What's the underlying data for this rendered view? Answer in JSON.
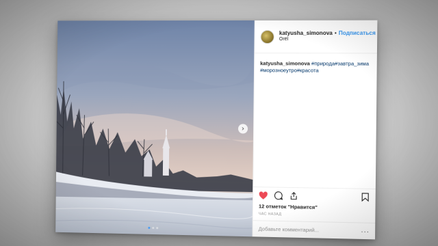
{
  "post": {
    "username": "katyusha_simonova",
    "follow_label": "Подписаться",
    "location": "Orël",
    "caption_user": "katyusha_simonova",
    "caption_tags": "#природа#завтра_зима#морозноеутро#красота",
    "likes_text": "12 отметок \"Нравится\"",
    "time_text": "час назад",
    "comment_placeholder": "Добавьте комментарий...",
    "more_glyph": "···",
    "next_glyph": "›",
    "bullet": "•"
  },
  "photo": {
    "subject": "frozen river at dawn with bell tower and bare trees",
    "slide_count": 3,
    "active_slide": 1
  },
  "icons": {
    "like": "heart-icon",
    "comment": "comment-icon",
    "share": "share-icon",
    "save": "bookmark-icon",
    "like_color": "#ed4956"
  },
  "colors": {
    "accent": "#3897f0",
    "text": "#262626",
    "muted": "#999999"
  }
}
